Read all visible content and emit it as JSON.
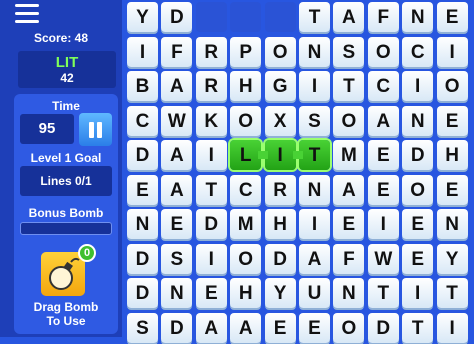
{
  "sidebar": {
    "score_label": "Score: 48",
    "current_word": "LIT",
    "current_word_points": "42",
    "time_label": "Time",
    "time_value": "95",
    "goal_label": "Level 1 Goal",
    "goal_value": "Lines 0/1",
    "bonus_label": "Bonus Bomb",
    "bonus_progress": 0,
    "bomb_count": "0",
    "bomb_caption_line1": "Drag Bomb",
    "bomb_caption_line2": "To Use"
  },
  "board": {
    "rows": [
      [
        "Y",
        "D",
        "",
        "",
        "",
        "T",
        "A",
        "F",
        "N",
        "E"
      ],
      [
        "I",
        "F",
        "R",
        "P",
        "O",
        "N",
        "S",
        "O",
        "C",
        "I"
      ],
      [
        "B",
        "A",
        "R",
        "H",
        "G",
        "I",
        "T",
        "C",
        "I",
        "O"
      ],
      [
        "C",
        "W",
        "K",
        "O",
        "X",
        "S",
        "O",
        "A",
        "N",
        "E"
      ],
      [
        "D",
        "A",
        "I",
        "L",
        "I",
        "T",
        "M",
        "E",
        "D",
        "H"
      ],
      [
        "E",
        "A",
        "T",
        "C",
        "R",
        "N",
        "A",
        "E",
        "O",
        "E"
      ],
      [
        "N",
        "E",
        "D",
        "M",
        "H",
        "I",
        "E",
        "I",
        "E",
        "N"
      ],
      [
        "D",
        "S",
        "I",
        "O",
        "D",
        "A",
        "F",
        "W",
        "E",
        "Y"
      ],
      [
        "D",
        "N",
        "E",
        "H",
        "Y",
        "U",
        "N",
        "T",
        "I",
        "T"
      ],
      [
        "S",
        "D",
        "A",
        "A",
        "E",
        "E",
        "O",
        "D",
        "T",
        "I"
      ]
    ],
    "selected": [
      [
        4,
        3
      ],
      [
        4,
        4
      ],
      [
        4,
        5
      ]
    ]
  },
  "colors": {
    "background": "#2856e0",
    "selected_tile": "#49d235",
    "current_word": "#7fff59",
    "bomb": "#f3a60e"
  }
}
